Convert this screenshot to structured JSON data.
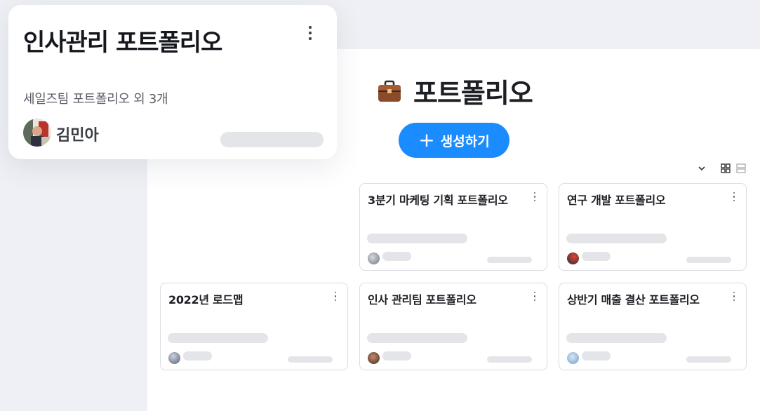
{
  "panel": {
    "title": "포트폴리오",
    "title_icon": "briefcase-icon",
    "create_label": "생성하기",
    "create_icon": "plus-icon"
  },
  "view_controls": {
    "sort_icon": "chevron-down-icon",
    "grid_icon": "grid-view-icon",
    "list_icon": "list-view-icon"
  },
  "cards": [
    {
      "title": "3분기 마케팅 기획 포트폴리오",
      "avatar_color": "#9aa0a8"
    },
    {
      "title": "연구 개발 포트폴리오",
      "avatar_color": "#c0392b"
    },
    {
      "title": "2022년 로드맵",
      "avatar_color": "#7a8aa0"
    },
    {
      "title": "인사 관리팀 포트폴리오",
      "avatar_color": "#6b4a3a"
    },
    {
      "title": "상반기 매출 결산 포트폴리오",
      "avatar_color": "#8fb3d9"
    }
  ],
  "featured": {
    "title": "인사관리 포트폴리오",
    "subtitle": "세일즈팀 포트폴리오 외 3개",
    "owner": "김민아"
  },
  "colors": {
    "accent": "#1a8cff",
    "background": "#eef0f5",
    "skeleton": "#e4e5e8"
  }
}
